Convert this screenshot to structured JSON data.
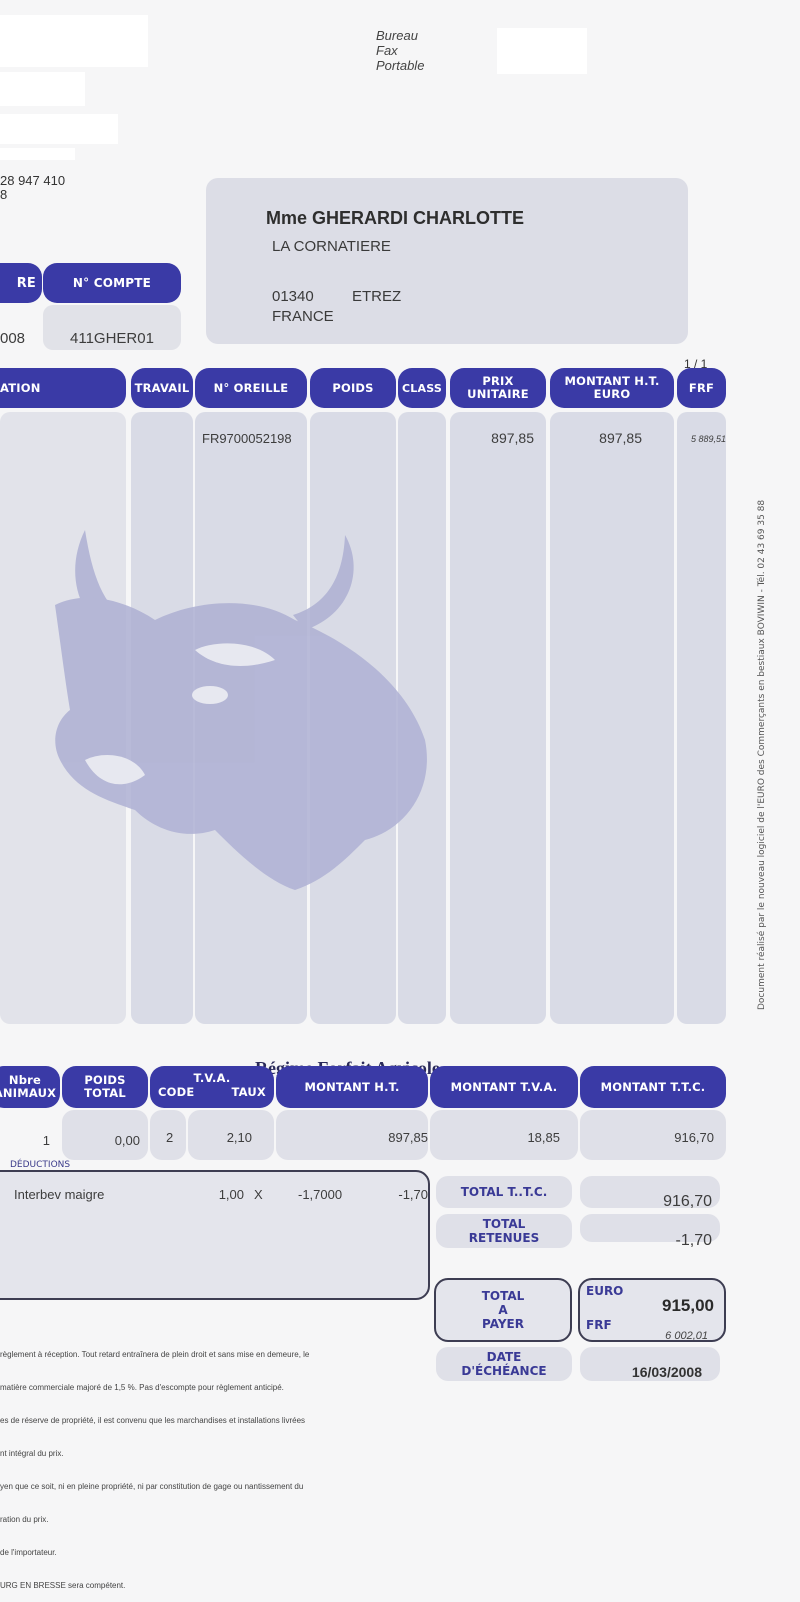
{
  "header": {
    "contact_labels": [
      "Bureau",
      "Fax",
      "Portable"
    ],
    "company_partial_lines": [
      "28 947 410",
      "8"
    ]
  },
  "recipient": {
    "name": "Mme GHERARDI CHARLOTTE",
    "line1": "LA CORNATIERE",
    "postal_code": "01340",
    "city": "ETREZ",
    "country": "FRANCE"
  },
  "account": {
    "left_header_partial": "RE",
    "left_value_partial": "008",
    "compte_header": "N° COMPTE",
    "compte_value": "411GHER01"
  },
  "page_indicator": "1 / 1",
  "lines_table": {
    "headers": {
      "designation_partial": "ATION",
      "travail": "TRAVAIL",
      "oreille": "N° OREILLE",
      "poids": "POIDS",
      "class": "CLASS",
      "prix_line1": "PRIX",
      "prix_line2": "UNITAIRE",
      "montant_line1": "MONTANT H.T.",
      "montant_line2": "EURO",
      "frf": "FRF"
    },
    "rows": [
      {
        "oreille": "FR9700052198",
        "prix_unitaire": "897,85",
        "montant_ht": "897,85",
        "frf": "5 889,51"
      }
    ]
  },
  "side_note": "Document réalisé par le nouveau logiciel de l'EURO des Commerçants en bestiaux BOVIWIN - Tél. 02 43 69 35 88",
  "regime": "Régime Forfait Agricole",
  "totals_table": {
    "headers": {
      "nbre_line1": "Nbre",
      "nbre_line2": "ANIMAUX",
      "poids_line1": "POIDS",
      "poids_line2": "TOTAL",
      "tva": "T.V.A.",
      "code": "CODE",
      "taux": "TAUX",
      "montant_ht": "MONTANT H.T.",
      "montant_tva": "MONTANT T.V.A.",
      "montant_ttc": "MONTANT T.T.C."
    },
    "row": {
      "nbre": "1",
      "poids": "0,00",
      "code": "2",
      "taux": "2,10",
      "montant_ht": "897,85",
      "montant_tva": "18,85",
      "montant_ttc": "916,70"
    }
  },
  "deductions": {
    "label": "DÉDUCTIONS",
    "items": [
      {
        "label": "Interbev maigre",
        "qty": "1,00",
        "x": "X",
        "unit": "-1,7000",
        "amount": "-1,70"
      }
    ]
  },
  "summary": {
    "total_ttc_label": "TOTAL T..T.C.",
    "total_ttc_value": "916,70",
    "total_retenues_line1": "TOTAL",
    "total_retenues_line2": "RETENUES",
    "total_retenues_value": "-1,70",
    "total_payer_line1": "TOTAL",
    "total_payer_line2": "A",
    "total_payer_line3": "PAYER",
    "euro_label": "EURO",
    "euro_value": "915,00",
    "frf_label": "FRF",
    "frf_value": "6 002,01",
    "echeance_line1": "DATE",
    "echeance_line2": "D'ÉCHÉANCE",
    "echeance_value": "16/03/2008"
  },
  "legal_lines": [
    "règlement à réception. Tout retard entraînera de plein droit et sans mise en demeure, le",
    "matière commerciale majoré de 1,5 %. Pas d'escompte pour règlement anticipé.",
    "es de réserve de propriété, il est convenu que les marchandises et installations livrées",
    "nt intégral du prix.",
    "yen que ce soit, ni en pleine propriété, ni par constitution de gage ou nantissement du",
    "ration du prix.",
    "de l'importateur.",
    "URG EN BRESSE sera compétent."
  ]
}
